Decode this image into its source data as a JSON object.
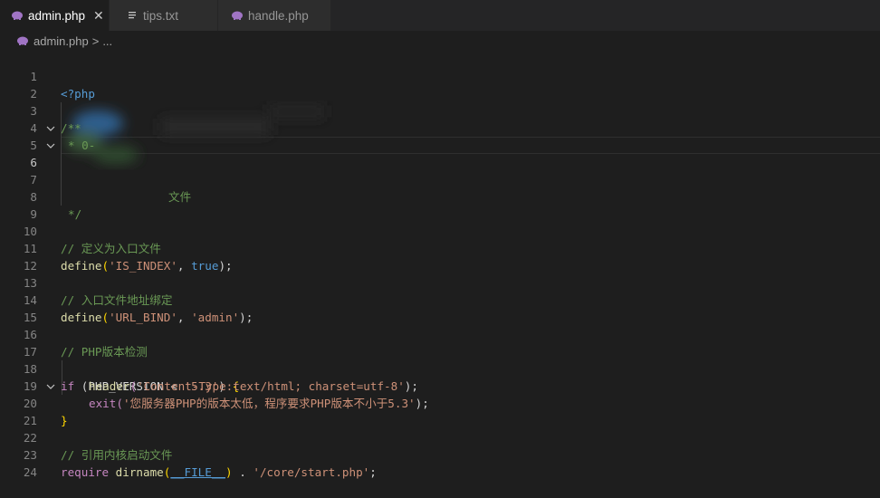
{
  "tabs": [
    {
      "label": "admin.php",
      "icon": "php-elephant-icon",
      "active": true
    },
    {
      "label": "tips.txt",
      "icon": "text-file-icon",
      "active": false
    },
    {
      "label": "handle.php",
      "icon": "php-elephant-icon",
      "active": false
    }
  ],
  "close_glyph": "✕",
  "breadcrumb": {
    "file": "admin.php",
    "separator": ">",
    "more": "..."
  },
  "lines": {
    "n1": "1",
    "n2": "2",
    "n3": "3",
    "n4": "4",
    "n5": "5",
    "n6": "6",
    "n7": "7",
    "n8": "8",
    "n9": "9",
    "n10": "10",
    "n11": "11",
    "n12": "12",
    "n13": "13",
    "n14": "14",
    "n15": "15",
    "n16": "16",
    "n17": "17",
    "n18": "18",
    "n19": "19",
    "n20": "20",
    "n21": "21",
    "n22": "22",
    "n23": "23",
    "n24": "24"
  },
  "code": {
    "php_open": "<?php",
    "doc_open": "/**",
    "doc_star4": "* 0-",
    "doc_tail7": "文件",
    "doc_close": "*/",
    "c10": "// 定义为入口文件",
    "l11_fn": "define",
    "l11_s1": "'IS_INDEX'",
    "l11_comma": ", ",
    "l11_const": "true",
    "l11_end": ");",
    "c13": "// 入口文件地址绑定",
    "l14_fn": "define",
    "l14_s1": "'URL_BIND'",
    "l14_comma": ", ",
    "l14_s2": "'admin'",
    "l14_end": ");",
    "c16": "// PHP版本检测",
    "l17_if": "if",
    "l17_a": " (PHP_VERSION < ",
    "l17_s": "'5.3'",
    "l17_b": ") ",
    "l17_brace": "{",
    "l18_fn": "header",
    "l18_s": "'Content-Type:text/html; charset=utf-8'",
    "l18_end": ");",
    "l19_fn": "exit",
    "l19_s": "'您服务器PHP的版本太低，程序要求PHP版本不小于5.3'",
    "l19_end": ");",
    "l20_brace": "}",
    "c22": "// 引用内核启动文件",
    "l23_req": "require",
    "l23_fn": "dirname",
    "l23_const": "__FILE__",
    "l23_dot": " . ",
    "l23_s": "'/core/start.php'",
    "l23_end": ";"
  },
  "colors": {
    "background": "#1e1e1e",
    "comment": "#6a9955",
    "keyword": "#569cd6",
    "string": "#ce9178",
    "function": "#dcdcaa",
    "control": "#c586c0"
  }
}
